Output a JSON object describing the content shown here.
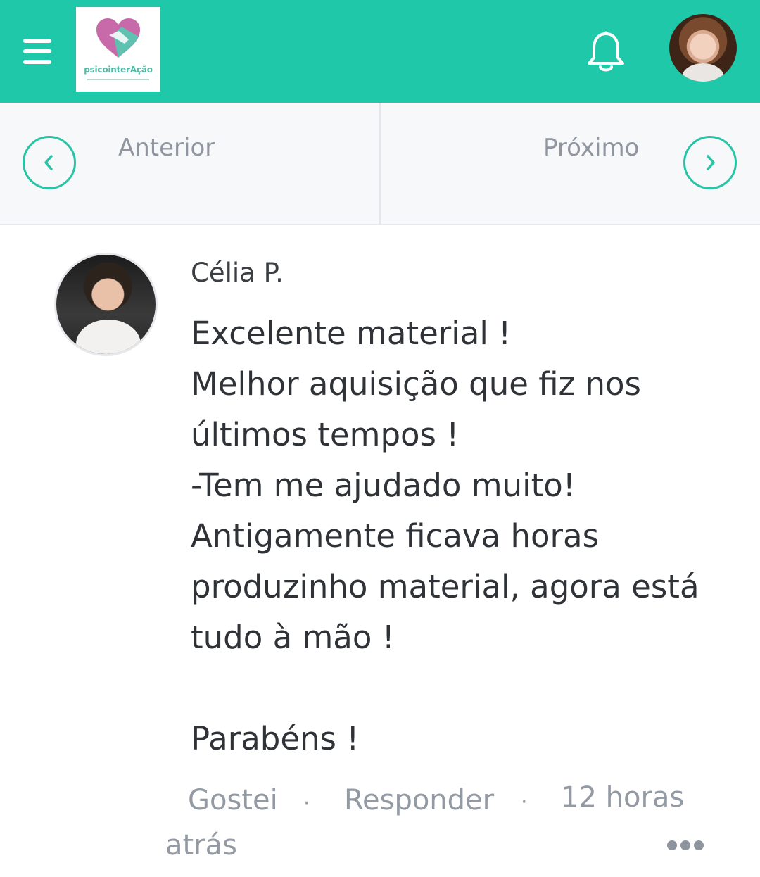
{
  "header": {
    "menu_icon": "hamburger-menu-icon",
    "logo_text": "psicointerAção",
    "bell_icon": "bell-icon",
    "avatar": "user-avatar",
    "brand_color": "#1fc8a8"
  },
  "navigation": {
    "prev_label": "Anterior",
    "next_label": "Próximo",
    "prev_icon": "chevron-left-icon",
    "next_icon": "chevron-right-icon",
    "accent_color": "#27c4a5"
  },
  "comment": {
    "author": "Célia P.",
    "lines": [
      "Excelente material !",
      "Melhor aquisição que fiz nos",
      "últimos tempos !",
      "-Tem me ajudado muito!",
      "Antigamente ficava horas",
      "produzinho material, agora está",
      "tudo à mão !",
      "",
      "Parabéns !"
    ],
    "like_label": "Gostei",
    "separator": "·",
    "reply_label": "Responder",
    "time_part1": "12 horas",
    "time_part2": "atrás",
    "more_icon": "more-options-icon"
  }
}
